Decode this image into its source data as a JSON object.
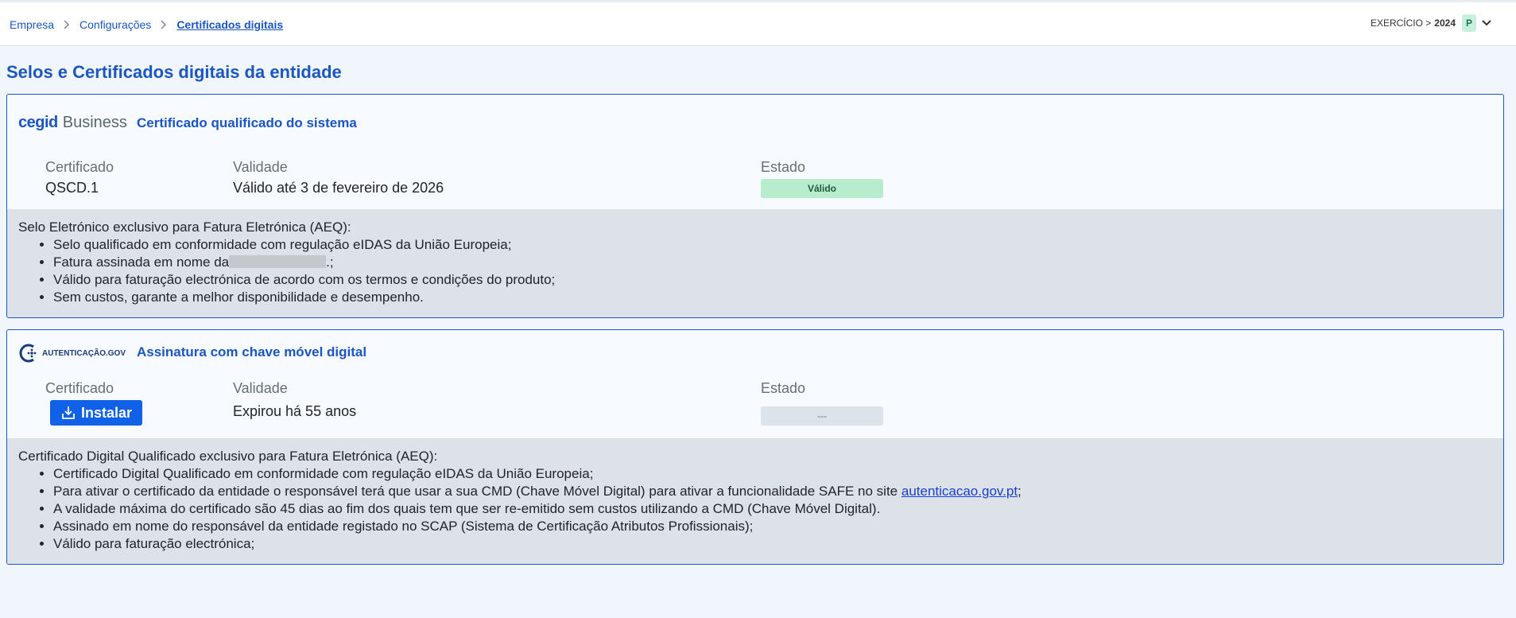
{
  "breadcrumb": {
    "items": [
      "Empresa",
      "Configurações",
      "Certificados digitais"
    ]
  },
  "exercise": {
    "label": "EXERCÍCIO >",
    "year": "2024",
    "badge": "P"
  },
  "page": {
    "title": "Selos e Certificados digitais da entidade"
  },
  "system_cert": {
    "brand_primary": "cegid",
    "brand_secondary": "Business",
    "title": "Certificado qualificado do sistema",
    "labels": {
      "certificate": "Certificado",
      "validity": "Validade",
      "status": "Estado"
    },
    "certificate": "QSCD.1",
    "validity": "Válido até 3 de fevereiro de 2026",
    "status": "Válido",
    "info_title": "Selo Eletrónico exclusivo para Fatura Eletrónica (AEQ):",
    "bullets": [
      "Selo qualificado em conformidade com regulação eIDAS da União Europeia;",
      "Fatura assinada em nome da",
      "Válido para faturação electrónica de acordo com os termos e condições do produto;",
      "Sem custos, garante a melhor disponibilidade e desempenho."
    ],
    "bullet2_suffix": ".;"
  },
  "cmd_cert": {
    "brand": "AUTENTICAÇÃO.GOV",
    "title": "Assinatura com chave móvel digital",
    "labels": {
      "certificate": "Certificado",
      "validity": "Validade",
      "status": "Estado"
    },
    "install_label": "Instalar",
    "validity": "Expirou há 55 anos",
    "status": "---",
    "info_title": "Certificado Digital Qualificado exclusivo para Fatura Eletrónica (AEQ):",
    "bullet1": "Certificado Digital Qualificado em conformidade com regulação eIDAS da União Europeia;",
    "bullet2_prefix": "Para ativar o certificado da entidade o responsável terá que usar a sua CMD (Chave Móvel Digital) para ativar a funcionalidade SAFE no site",
    "bullet2_link": "autenticacao.gov.pt",
    "bullet2_suffix": ";",
    "bullet3": "A validade máxima do certificado são 45 dias ao fim dos quais tem que ser re-emitido sem custos utilizando a CMD (Chave Móvel Digital).",
    "bullet4": "Assinado em nome do responsável da entidade registado no SCAP (Sistema de Certificação Atributos Profissionais);",
    "bullet5": "Válido para faturação electrónica;"
  },
  "colors": {
    "accent": "#1a56c4",
    "button": "#1060e8",
    "valid_bg": "#b7eccd",
    "info_bg": "#dde1e8"
  }
}
